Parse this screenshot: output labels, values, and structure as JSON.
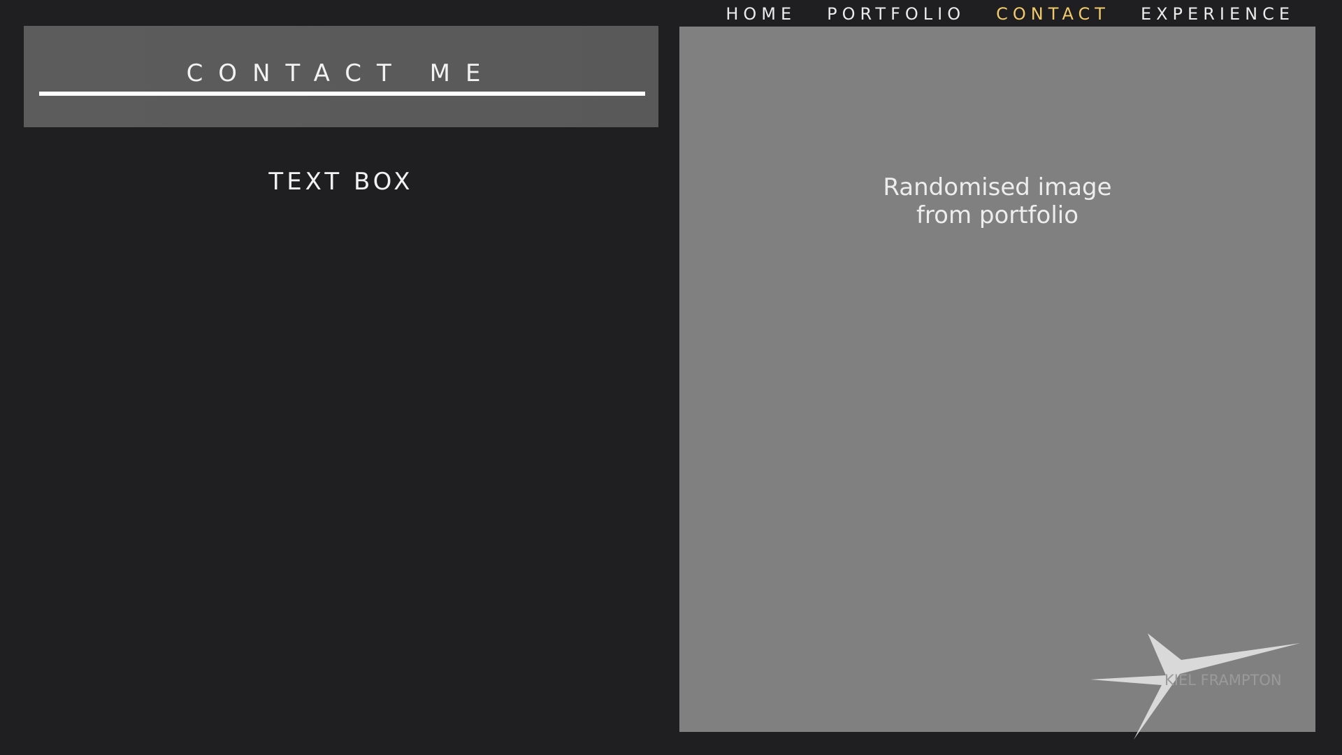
{
  "nav": {
    "items": [
      {
        "label": "HOME"
      },
      {
        "label": "PORTFOLIO"
      },
      {
        "label": "CONTACT"
      },
      {
        "label": "EXPERIENCE"
      }
    ],
    "active": "CONTACT",
    "active_color": "#f1ca6b"
  },
  "header": {
    "title": "CONTACT ME"
  },
  "main": {
    "textbox_label": "TEXT BOX"
  },
  "image_panel": {
    "caption_line1": "Randomised image",
    "caption_line2": "from portfolio"
  },
  "logo": {
    "text": "KIEL FRAMPTON"
  },
  "colors": {
    "background": "#1f1f21",
    "title_panel": "#5c5c5c",
    "image_panel": "#808080",
    "nav_text": "#ebebeb"
  }
}
